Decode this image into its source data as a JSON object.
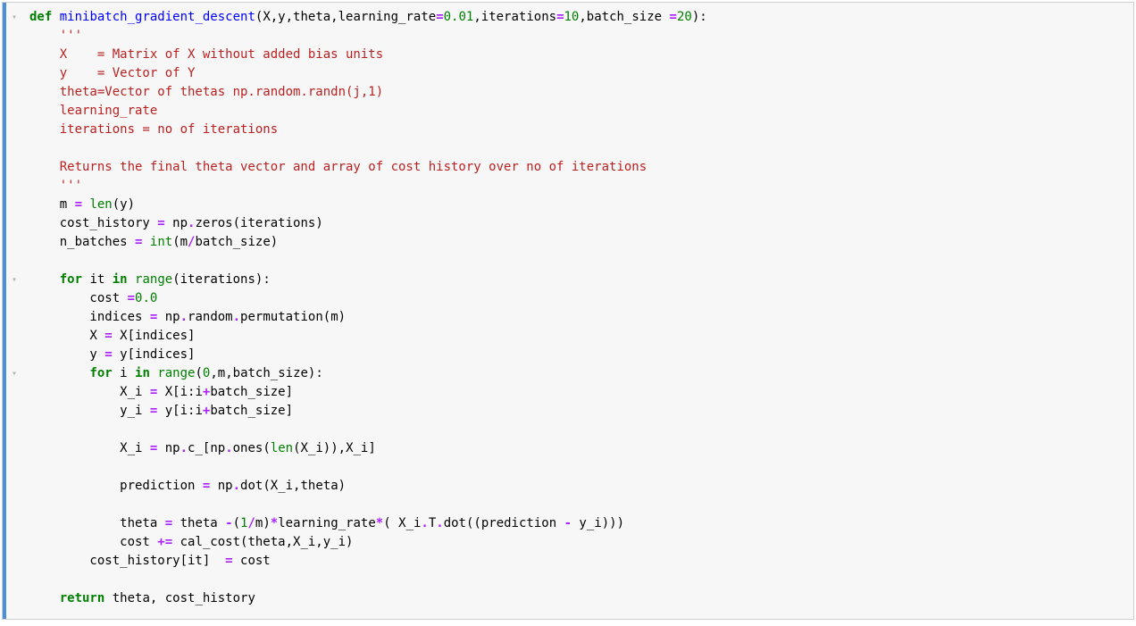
{
  "code": {
    "l01a": "def",
    "l01b": " ",
    "l01c": "minibatch_gradient_descent",
    "l01d": "(X,y,theta,learning_rate",
    "l01e": "=",
    "l01f": "0.01",
    "l01g": ",iterations",
    "l01h": "=",
    "l01i": "10",
    "l01j": ",batch_size ",
    "l01k": "=",
    "l01l": "20",
    "l01m": "):",
    "l02": "    '''",
    "l03": "    X    = Matrix of X without added bias units",
    "l04": "    y    = Vector of Y",
    "l05": "    theta=Vector of thetas np.random.randn(j,1)",
    "l06": "    learning_rate ",
    "l07": "    iterations = no of iterations",
    "l08": "    ",
    "l09": "    Returns the final theta vector and array of cost history over no of iterations",
    "l10": "    '''",
    "l11a": "    m ",
    "l11b": "=",
    "l11c": " ",
    "l11d": "len",
    "l11e": "(y)",
    "l12a": "    cost_history ",
    "l12b": "=",
    "l12c": " np",
    "l12d": ".",
    "l12e": "zeros(iterations)",
    "l13a": "    n_batches ",
    "l13b": "=",
    "l13c": " ",
    "l13d": "int",
    "l13e": "(m",
    "l13f": "/",
    "l13g": "batch_size)",
    "l14": "    ",
    "l15a": "    ",
    "l15b": "for",
    "l15c": " it ",
    "l15d": "in",
    "l15e": " ",
    "l15f": "range",
    "l15g": "(iterations):",
    "l16a": "        cost ",
    "l16b": "=",
    "l16c": "0.0",
    "l17a": "        indices ",
    "l17b": "=",
    "l17c": " np",
    "l17d": ".",
    "l17e": "random",
    "l17f": ".",
    "l17g": "permutation(m)",
    "l18a": "        X ",
    "l18b": "=",
    "l18c": " X[indices]",
    "l19a": "        y ",
    "l19b": "=",
    "l19c": " y[indices]",
    "l20a": "        ",
    "l20b": "for",
    "l20c": " i ",
    "l20d": "in",
    "l20e": " ",
    "l20f": "range",
    "l20g": "(",
    "l20h": "0",
    "l20i": ",m,batch_size):",
    "l21a": "            X_i ",
    "l21b": "=",
    "l21c": " X[i:i",
    "l21d": "+",
    "l21e": "batch_size]",
    "l22a": "            y_i ",
    "l22b": "=",
    "l22c": " y[i:i",
    "l22d": "+",
    "l22e": "batch_size]",
    "l23": "            ",
    "l24a": "            X_i ",
    "l24b": "=",
    "l24c": " np",
    "l24d": ".",
    "l24e": "c_[np",
    "l24f": ".",
    "l24g": "ones(",
    "l24h": "len",
    "l24i": "(X_i)),X_i]",
    "l25": "            ",
    "l26a": "            prediction ",
    "l26b": "=",
    "l26c": " np",
    "l26d": ".",
    "l26e": "dot(X_i,theta)",
    "l27": "",
    "l28a": "            theta ",
    "l28b": "=",
    "l28c": " theta ",
    "l28d": "-",
    "l28e": "(",
    "l28f": "1",
    "l28g": "/",
    "l28h": "m)",
    "l28i": "*",
    "l28j": "learning_rate",
    "l28k": "*",
    "l28l": "( X_i",
    "l28m": ".",
    "l28n": "T",
    "l28o": ".",
    "l28p": "dot((prediction ",
    "l28q": "-",
    "l28r": " y_i)))",
    "l29a": "            cost ",
    "l29b": "+=",
    "l29c": " cal_cost(theta,X_i,y_i)",
    "l30a": "        cost_history[it]  ",
    "l30b": "=",
    "l30c": " cost",
    "l31": "        ",
    "l32a": "    ",
    "l32b": "return",
    "l32c": " theta, cost_history"
  },
  "fold_glyph": "▾"
}
